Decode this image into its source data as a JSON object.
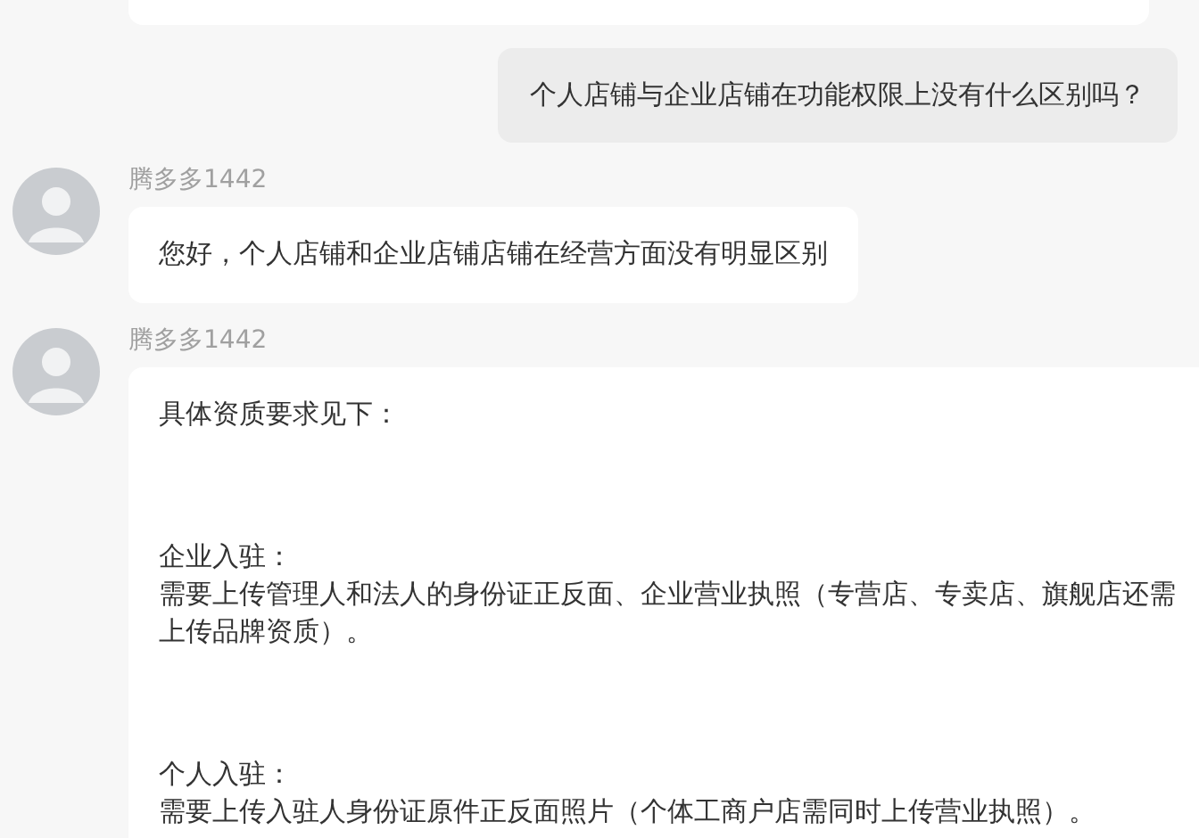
{
  "messages": [
    {
      "kind": "outgoing",
      "paragraphs": [
        {
          "lines": [
            "个人店铺与企业店铺在功能权限上没有什么区别吗？"
          ]
        }
      ]
    },
    {
      "kind": "incoming",
      "sender": "腾多多1442",
      "paragraphs": [
        {
          "lines": [
            "您好，个人店铺和企业店铺店铺在经营方面没有明显区别"
          ]
        }
      ]
    },
    {
      "kind": "incoming",
      "sender": "腾多多1442",
      "paragraphs": [
        {
          "lines": [
            "具体资质要求见下："
          ]
        },
        {
          "lines": [
            "企业入驻：",
            "需要上传管理人和法人的身份证正反面、企业营业执照（专营店、专卖店、旗舰店还需上传品牌资质）。"
          ]
        },
        {
          "lines": [
            "个人入驻：",
            "需要上传入驻人身份证原件正反面照片（个体工商户店需同时上传营业执照）。"
          ]
        }
      ]
    }
  ]
}
